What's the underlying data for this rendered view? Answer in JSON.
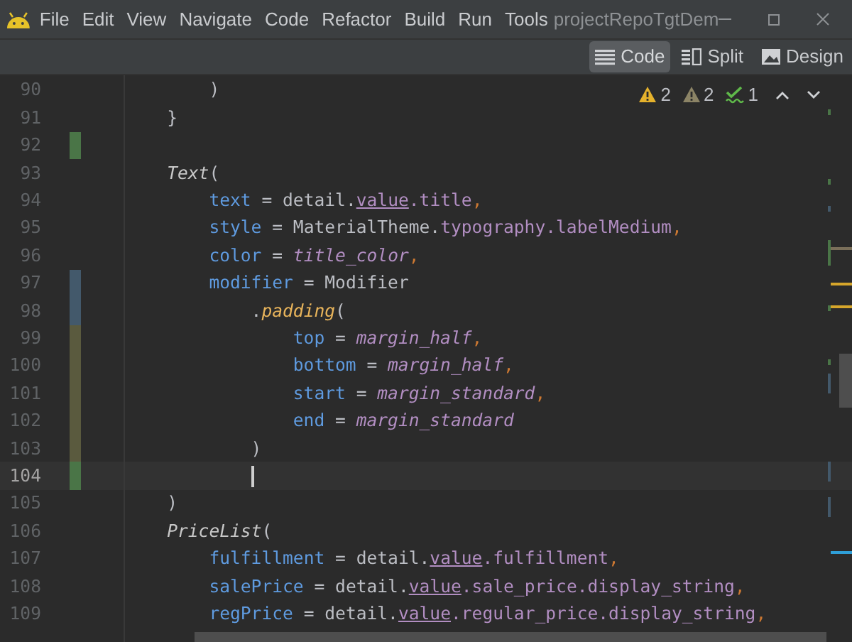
{
  "menu": [
    "File",
    "Edit",
    "View",
    "Navigate",
    "Code",
    "Refactor",
    "Build",
    "Run",
    "Tools"
  ],
  "window": {
    "title": "projectRepoTgtDem"
  },
  "view_modes": [
    {
      "label": "Code",
      "kind": "code",
      "selected": true
    },
    {
      "label": "Split",
      "kind": "split",
      "selected": false
    },
    {
      "label": "Design",
      "kind": "design",
      "selected": false
    }
  ],
  "inspections": [
    {
      "kind": "warning",
      "count": "2"
    },
    {
      "kind": "weak_warning",
      "count": "2"
    },
    {
      "kind": "typo",
      "count": "1"
    }
  ],
  "lines": [
    {
      "number": "90",
      "current": false,
      "kind": "argument",
      "tokens": [
        {
          "kind": "plain",
          "text": ")"
        }
      ]
    },
    {
      "number": "91",
      "current": false,
      "kind": "statement",
      "tokens": [
        {
          "kind": "plain",
          "text": "}"
        }
      ]
    },
    {
      "number": "92",
      "current": false,
      "kind": "blank",
      "color": "#4a7547"
    },
    {
      "number": "93",
      "current": false,
      "kind": "statement",
      "tokens": [
        {
          "kind": "function",
          "text": "Text"
        },
        {
          "kind": "plain",
          "text": "("
        }
      ]
    },
    {
      "number": "94",
      "current": false,
      "kind": "argument",
      "tokens": [
        {
          "kind": "arg",
          "text": "text"
        },
        {
          "kind": "plain",
          "text": " = detail."
        },
        {
          "kind": "extension",
          "text": "value"
        },
        {
          "kind": "property",
          "text": ".title"
        },
        {
          "kind": "comma",
          "text": ","
        }
      ]
    },
    {
      "number": "95",
      "current": false,
      "kind": "argument",
      "tokens": [
        {
          "kind": "arg",
          "text": "style"
        },
        {
          "kind": "plain",
          "text": " = MaterialTheme."
        },
        {
          "kind": "property",
          "text": "typography.labelMedium"
        },
        {
          "kind": "comma",
          "text": ","
        }
      ]
    },
    {
      "number": "96",
      "current": false,
      "kind": "argument",
      "tokens": [
        {
          "kind": "arg",
          "text": "color"
        },
        {
          "kind": "plain",
          "text": " = "
        },
        {
          "kind": "variable",
          "text": "title_color"
        },
        {
          "kind": "comma",
          "text": ","
        }
      ]
    },
    {
      "number": "97",
      "current": false,
      "color": "#43596b",
      "kind": "argument",
      "tokens": [
        {
          "kind": "arg",
          "text": "modifier"
        },
        {
          "kind": "plain",
          "text": " = Modifier"
        }
      ]
    },
    {
      "number": "98",
      "current": false,
      "color": "#43596b",
      "kind": "chained",
      "tokens": [
        {
          "kind": "plain",
          "text": "."
        },
        {
          "kind": "method",
          "text": "padding"
        },
        {
          "kind": "plain",
          "text": "("
        }
      ]
    },
    {
      "number": "99",
      "current": false,
      "color": "#5a5a3e",
      "kind": "nested",
      "tokens": [
        {
          "kind": "arg",
          "text": "top"
        },
        {
          "kind": "plain",
          "text": " = "
        },
        {
          "kind": "variable",
          "text": "margin_half"
        },
        {
          "kind": "comma",
          "text": ","
        }
      ]
    },
    {
      "number": "100",
      "current": false,
      "color": "#5a5a3e",
      "kind": "nested",
      "tokens": [
        {
          "kind": "arg",
          "text": "bottom"
        },
        {
          "kind": "plain",
          "text": " = "
        },
        {
          "kind": "variable",
          "text": "margin_half"
        },
        {
          "kind": "comma",
          "text": ","
        }
      ]
    },
    {
      "number": "101",
      "current": false,
      "color": "#5a5a3e",
      "kind": "nested",
      "tokens": [
        {
          "kind": "arg",
          "text": "start"
        },
        {
          "kind": "plain",
          "text": " = "
        },
        {
          "kind": "variable",
          "text": "margin_standard"
        },
        {
          "kind": "comma",
          "text": ","
        }
      ]
    },
    {
      "number": "102",
      "current": false,
      "color": "#5a5a3e",
      "kind": "nested",
      "tokens": [
        {
          "kind": "arg",
          "text": "end"
        },
        {
          "kind": "plain",
          "text": " = "
        },
        {
          "kind": "variable",
          "text": "margin_standard"
        }
      ]
    },
    {
      "number": "103",
      "current": false,
      "color": "#5a5a3e",
      "kind": "chained",
      "tokens": [
        {
          "kind": "plain",
          "text": ")"
        }
      ]
    },
    {
      "number": "104",
      "current": true,
      "color": "#4a7547",
      "kind": "chained"
    },
    {
      "number": "105",
      "current": false,
      "kind": "statement",
      "tokens": [
        {
          "kind": "plain",
          "text": ")"
        }
      ]
    },
    {
      "number": "106",
      "current": false,
      "kind": "statement",
      "tokens": [
        {
          "kind": "function",
          "text": "PriceList"
        },
        {
          "kind": "plain",
          "text": "("
        }
      ]
    },
    {
      "number": "107",
      "current": false,
      "kind": "argument",
      "tokens": [
        {
          "kind": "arg",
          "text": "fulfillment"
        },
        {
          "kind": "plain",
          "text": " = detail."
        },
        {
          "kind": "extension",
          "text": "value"
        },
        {
          "kind": "property",
          "text": ".fulfillment"
        },
        {
          "kind": "comma",
          "text": ","
        }
      ]
    },
    {
      "number": "108",
      "current": false,
      "kind": "argument",
      "tokens": [
        {
          "kind": "arg",
          "text": "salePrice"
        },
        {
          "kind": "plain",
          "text": " = detail."
        },
        {
          "kind": "extension",
          "text": "value"
        },
        {
          "kind": "property",
          "text": ".sale_price.display_string"
        },
        {
          "kind": "comma",
          "text": ","
        }
      ]
    },
    {
      "number": "109",
      "current": false,
      "kind": "argument",
      "tokens": [
        {
          "kind": "arg",
          "text": "regPrice"
        },
        {
          "kind": "plain",
          "text": " = detail."
        },
        {
          "kind": "extension",
          "text": "value"
        },
        {
          "kind": "property",
          "text": ".regular_price.display_string"
        },
        {
          "kind": "comma",
          "text": ","
        }
      ]
    }
  ]
}
